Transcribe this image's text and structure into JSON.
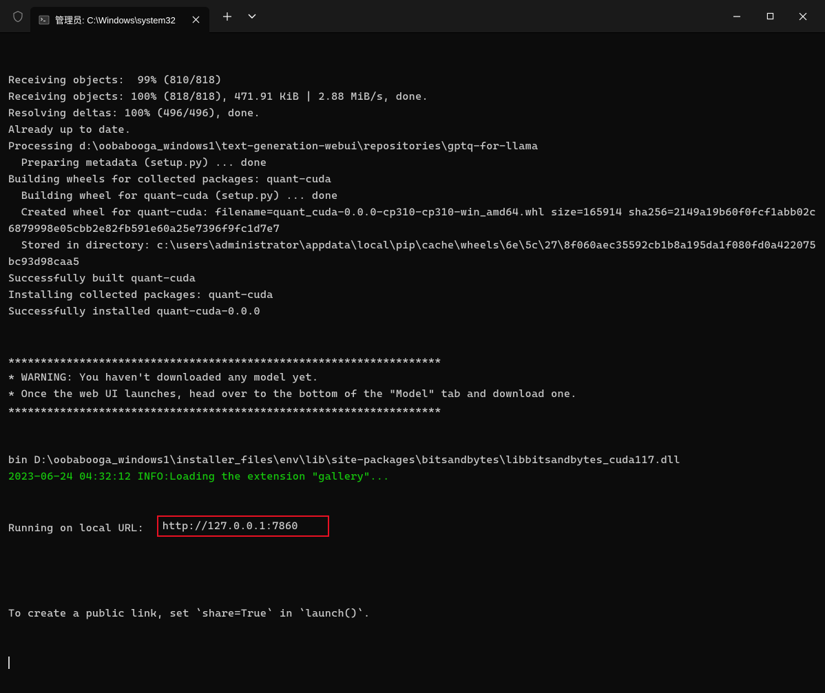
{
  "titlebar": {
    "tab_title": "管理员: C:\\Windows\\system32",
    "tab_icon_name": "terminal-icon"
  },
  "terminal": {
    "lines": [
      {
        "text": "Receiving objects:  99% (810/818)",
        "cls": ""
      },
      {
        "text": "Receiving objects: 100% (818/818), 471.91 KiB | 2.88 MiB/s, done.",
        "cls": ""
      },
      {
        "text": "Resolving deltas: 100% (496/496), done.",
        "cls": ""
      },
      {
        "text": "Already up to date.",
        "cls": ""
      },
      {
        "text": "Processing d:\\oobabooga_windows1\\text-generation-webui\\repositories\\gptq-for-llama",
        "cls": ""
      },
      {
        "text": "  Preparing metadata (setup.py) ... done",
        "cls": ""
      },
      {
        "text": "Building wheels for collected packages: quant-cuda",
        "cls": ""
      },
      {
        "text": "  Building wheel for quant-cuda (setup.py) ... done",
        "cls": ""
      },
      {
        "text": "  Created wheel for quant-cuda: filename=quant_cuda-0.0.0-cp310-cp310-win_amd64.whl size=165914 sha256=2149a19b60f0fcf1abb02c6879998e05cbb2e82fb591e60a25e7396f9fc1d7e7",
        "cls": ""
      },
      {
        "text": "  Stored in directory: c:\\users\\administrator\\appdata\\local\\pip\\cache\\wheels\\6e\\5c\\27\\8f060aec35592cb1b8a195da1f080fd0a422075bc93d98caa5",
        "cls": ""
      },
      {
        "text": "Successfully built quant-cuda",
        "cls": ""
      },
      {
        "text": "Installing collected packages: quant-cuda",
        "cls": ""
      },
      {
        "text": "Successfully installed quant-cuda-0.0.0",
        "cls": ""
      },
      {
        "text": "",
        "cls": ""
      },
      {
        "text": "",
        "cls": ""
      },
      {
        "text": "*******************************************************************",
        "cls": ""
      },
      {
        "text": "* WARNING: You haven't downloaded any model yet.",
        "cls": ""
      },
      {
        "text": "* Once the web UI launches, head over to the bottom of the \"Model\" tab and download one.",
        "cls": ""
      },
      {
        "text": "*******************************************************************",
        "cls": ""
      },
      {
        "text": "",
        "cls": ""
      },
      {
        "text": "",
        "cls": ""
      },
      {
        "text": "bin D:\\oobabooga_windows1\\installer_files\\env\\lib\\site-packages\\bitsandbytes\\libbitsandbytes_cuda117.dll",
        "cls": ""
      },
      {
        "text": "2023-06-24 04:32:12 INFO:Loading the extension \"gallery\"...",
        "cls": "green"
      }
    ],
    "url_line_prefix": "Running on local URL:  ",
    "url_value": "http://127.0.0.1:7860",
    "blank_after_url": "",
    "share_line": "To create a public link, set `share=True` in `launch()`."
  }
}
